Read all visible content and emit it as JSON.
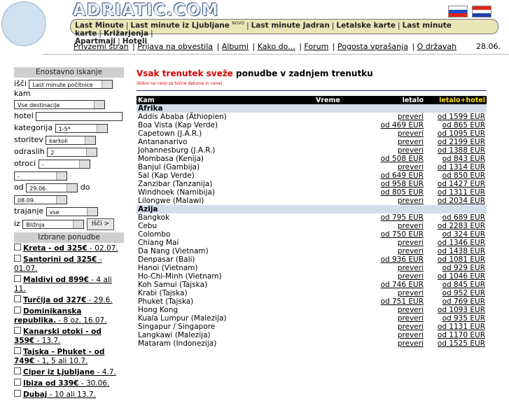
{
  "header": {
    "logo_text": "ADRIATIC.COM",
    "top_links": [
      "Last Minute",
      "Last minute iz Ljubljane",
      "Last minute Jadran",
      "Letalske karte",
      "Last minute karte",
      "Križarjenja",
      "Apartmaji",
      "Hoteli"
    ],
    "nova_badge": "NOVO",
    "sub_links": [
      "Privzemi stran",
      "Prijava na obvestila",
      "Albumi",
      "Kako do...",
      "Forum",
      "Pogosta vprašanja",
      "O državah"
    ],
    "date": "28.06."
  },
  "sidebar": {
    "search_title": "Enostavno iskanje",
    "isci_label": "išči",
    "isci_value": "Last minute počitnice",
    "kam_label": "kam",
    "kam_value": "Vse destinacije",
    "hotel_label": "hotel",
    "kategorija_label": "kategorija",
    "kategorija_value": "1-5*",
    "storitev_label": "storitev",
    "storitev_value": "karkoli",
    "odraslih_label": "odraslih",
    "odraslih_value": "2",
    "otroci_label": "otroci",
    "otroci_value": "-",
    "extra_value": "-",
    "od_label": "od",
    "od_value": "29.06.",
    "do_label": "do",
    "do_value": "08.09.",
    "trajanje_label": "trajanje",
    "trajanje_value": "vse",
    "iz_label": "iz",
    "iz_value": "Bližnja",
    "search_button": "Išči >",
    "offers_title": "Izbrane ponudbe",
    "offers": [
      {
        "title": "Kreta - od 325€",
        "rest": " - 02.07."
      },
      {
        "title": "Santorini od 325€",
        "rest": " - 01.07."
      },
      {
        "title": "Maldivi od 899€",
        "rest": " - 4 ali 11."
      },
      {
        "title": "Turčija od 327€",
        "rest": " - 29.6."
      },
      {
        "title": "Dominikanska republika.",
        "rest": " - 8 oz. 16.07."
      },
      {
        "title": "Kanarski otoki - od 359€",
        "rest": " - 13.7."
      },
      {
        "title": "Tajska - Phuket - od 749€",
        "rest": " - 1, 5 ali 10.7."
      },
      {
        "title": "Ciper iz Ljubljane",
        "rest": " - 4.7."
      },
      {
        "title": "Ibiza od 339€",
        "rest": " - 30.06."
      },
      {
        "title": "Dubaj",
        "rest": " - 10 ali 13.7."
      }
    ]
  },
  "main": {
    "title_red": "Vsak trenutek sveže",
    "title_black": " ponudbe v zadnjem trenutku",
    "note": "(klikni na ceno za točne datume in cene)",
    "columns": [
      "Kam",
      "Vreme",
      "letalo",
      "letalo+hotel"
    ],
    "groups": [
      {
        "name": "Afrika",
        "rows": [
          [
            "Addis Ababa (Äthiopien)",
            "preveri",
            "od 1599 EUR"
          ],
          [
            "Boa Vista (Kap Verde)",
            "od 469 EUR",
            "od 865 EUR"
          ],
          [
            "Capetown (J.A.R.)",
            "preveri",
            "od 1095 EUR"
          ],
          [
            "Antananarivo",
            "preveri",
            "od 2199 EUR"
          ],
          [
            "Johannesburg (J.A.R.)",
            "preveri",
            "od 1388 EUR"
          ],
          [
            "Mombasa (Kenija)",
            "od 508 EUR",
            "od 843 EUR"
          ],
          [
            "Banjul (Gambija)",
            "preveri",
            "od 1314 EUR"
          ],
          [
            "Sal (Kap Verde)",
            "od 649 EUR",
            "od 850 EUR"
          ],
          [
            "Zanzibar (Tanzanija)",
            "od 958 EUR",
            "od 1427 EUR"
          ],
          [
            "Windhoek (Namibija)",
            "od 805 EUR",
            "od 1311 EUR"
          ],
          [
            "Lilongwe (Malawi)",
            "preveri",
            "od 2034 EUR"
          ]
        ]
      },
      {
        "name": "Azija",
        "rows": [
          [
            "Bangkok",
            "od 795 EUR",
            "od 689 EUR"
          ],
          [
            "Cebu",
            "preveri",
            "od 2283 EUR"
          ],
          [
            "Colombo",
            "od 750 EUR",
            "od 324 EUR"
          ],
          [
            "Chiang Mai",
            "preveri",
            "od 1346 EUR"
          ],
          [
            "Da Nang (Vietnam)",
            "preveri",
            "od 1438 EUR"
          ],
          [
            "Denpasar (Bali)",
            "od 936 EUR",
            "od 1081 EUR"
          ],
          [
            "Hanoi (Vietnam)",
            "preveri",
            "od 929 EUR"
          ],
          [
            "Ho-Chi-Minh (Vietnam)",
            "preveri",
            "od 1046 EUR"
          ],
          [
            "Koh Samui (Tajska)",
            "od 746 EUR",
            "od 845 EUR"
          ],
          [
            "Krabi (Tajska)",
            "preveri",
            "od 952 EUR"
          ],
          [
            "Phuket (Tajska)",
            "od 751 EUR",
            "od 769 EUR"
          ],
          [
            "Hong Kong",
            "preveri",
            "od 1093 EUR"
          ],
          [
            "Kuala Lumpur (Malezija)",
            "preveri",
            "od 935 EUR"
          ],
          [
            "Singapur / Singapore",
            "preveri",
            "od 1131 EUR"
          ],
          [
            "Langkawi (Malezija)",
            "preveri",
            "od 1170 EUR"
          ],
          [
            "Mataram (Indonezija)",
            "preveri",
            "od 1525 EUR"
          ]
        ]
      }
    ]
  }
}
